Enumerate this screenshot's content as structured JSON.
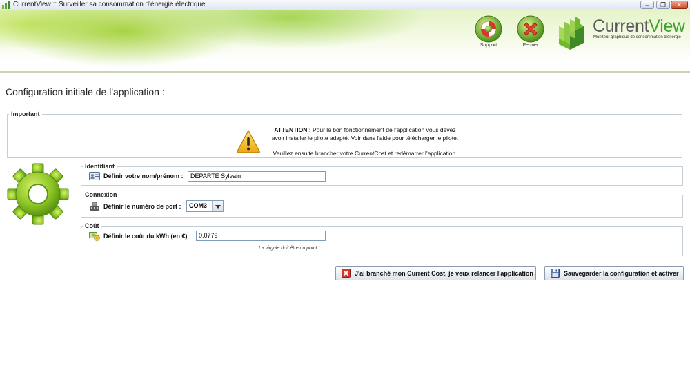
{
  "window": {
    "title": "CurrentView :: Surveiller sa consommation d'énergie électrique",
    "minimize_glyph": "–",
    "restore_glyph": "❐",
    "close_glyph": "✕"
  },
  "header": {
    "support_label": "Support",
    "close_label": "Fermer",
    "brand_current": "Current",
    "brand_view": "View",
    "brand_subtitle": "Moniteur graphique de consommation d'énergie"
  },
  "page": {
    "title": "Configuration initiale de l'application :"
  },
  "important": {
    "legend": "Important",
    "line1_bold": "ATTENTION :",
    "line1_rest": " Pour le bon fonctionnement de l'application vous devez",
    "line2": "avoir installer le pilote adapté. Voir dans l'aide pour télécharger le pilote.",
    "line3": "Veuillez ensuite brancher votre CurrentCost et redémarrer l'application."
  },
  "identifiant": {
    "legend": "Identifiant",
    "label": "Définir votre nom/prénom :",
    "value": "DEPARTE Sylvain"
  },
  "connexion": {
    "legend": "Connexion",
    "label": "Définir le numéro de port :",
    "selected": "COM3"
  },
  "cout": {
    "legend": "Coût",
    "label": "Définir le coût du kWh (en €) :",
    "value": "0.0779",
    "hint": "La virgule doit être un point !"
  },
  "actions": {
    "restart_label": "J'ai branché mon Current Cost, je veux relancer l'application",
    "save_label": "Sauvegarder la configuration et activer"
  },
  "icons": {
    "app": "current-view-app-icon",
    "support": "lifebuoy-icon",
    "close": "red-x-icon",
    "brand": "bar-graph-logo",
    "warning": "warning-triangle-icon",
    "gear": "green-gear-icon",
    "id": "id-card-icon",
    "port": "usb-port-icon",
    "cost": "money-icon",
    "restart": "red-close-square-icon",
    "save": "floppy-disk-icon"
  },
  "colors": {
    "accent_green": "#3fa12b",
    "banner_green": "#9ccd28",
    "warning_yellow": "#f3b51c",
    "error_red": "#d8362b"
  }
}
